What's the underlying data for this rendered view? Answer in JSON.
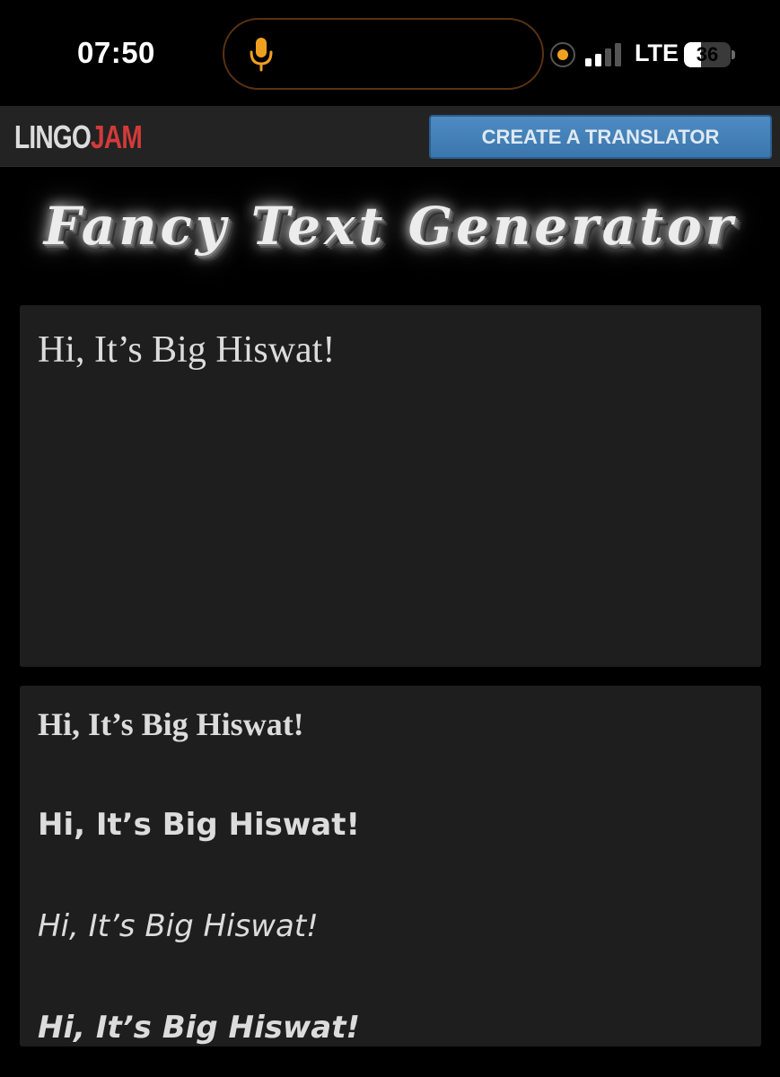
{
  "status_bar": {
    "time": "07:50",
    "network": "LTE",
    "battery_level": "36",
    "battery_fraction": 0.36,
    "signal_bars_active": 2,
    "signal_bars_total": 4,
    "accent_color": "#f0a020",
    "icons": [
      "microphone-icon",
      "orange-dot-icon",
      "signal-icon",
      "battery-icon"
    ]
  },
  "header": {
    "logo_part1": "LINGO",
    "logo_part2": "JAM",
    "logo_part2_color": "#d43a3a",
    "create_button_label": "CREATE A TRANSLATOR",
    "button_color": "#3b77ad"
  },
  "page": {
    "title": "Fancy Text Generator"
  },
  "input": {
    "value": "Hi, It’s Big Hiswat!"
  },
  "outputs": [
    {
      "text": "Hi, It’s Big Hiswat!"
    },
    {
      "text": "Hi, It’s Big Hiswat!"
    },
    {
      "text": "Hi, It’s Big Hiswat!"
    },
    {
      "text": "Hi, It’s Big Hiswat!"
    }
  ]
}
